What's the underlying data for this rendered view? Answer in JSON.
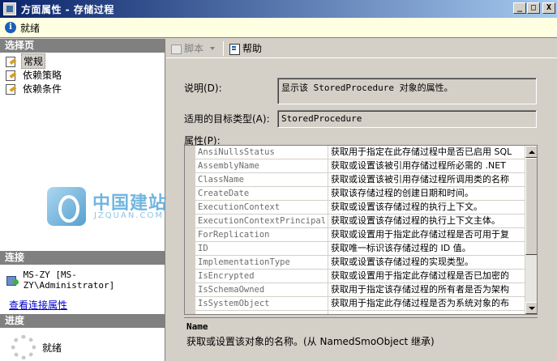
{
  "window": {
    "title": "方面属性 - 存储过程",
    "buttons": {
      "minimize": "_",
      "maximize": "□",
      "close": "X"
    }
  },
  "status": {
    "text": "就绪"
  },
  "left": {
    "select_page_header": "选择页",
    "pages": [
      {
        "label": "常规",
        "selected": true
      },
      {
        "label": "依赖策略",
        "selected": false
      },
      {
        "label": "依赖条件",
        "selected": false
      }
    ],
    "watermark": {
      "text": "中国建站圈",
      "sub": "JZQUAN.COM"
    },
    "connection_header": "连接",
    "connection_value": "MS-ZY [MS-ZY\\Administrator]",
    "connection_link": "查看连接属性",
    "progress_header": "进度",
    "progress_status": "就绪"
  },
  "toolbar": {
    "script_label": "脚本",
    "help_label": "帮助"
  },
  "form": {
    "description_label": "说明(D):",
    "description_value": "显示该 StoredProcedure 对象的属性。",
    "target_type_label": "适用的目标类型(A):",
    "target_type_value": "StoredProcedure",
    "properties_label": "属性(P):"
  },
  "properties": [
    {
      "name": "AnsiNullsStatus",
      "desc": "获取用于指定在此存储过程中是否已启用 SQL"
    },
    {
      "name": "AssemblyName",
      "desc": "获取或设置该被引用存储过程所必需的 .NET"
    },
    {
      "name": "ClassName",
      "desc": "获取或设置该被引用存储过程所调用类的名称"
    },
    {
      "name": "CreateDate",
      "desc": "获取该存储过程的创建日期和时间。"
    },
    {
      "name": "ExecutionContext",
      "desc": "获取或设置该存储过程的执行上下文。"
    },
    {
      "name": "ExecutionContextPrincipal",
      "desc": "获取或设置该存储过程的执行上下文主体。"
    },
    {
      "name": "ForReplication",
      "desc": "获取或设置用于指定此存储过程是否可用于复"
    },
    {
      "name": "ID",
      "desc": "获取唯一标识该存储过程的 ID 值。"
    },
    {
      "name": "ImplementationType",
      "desc": "获取或设置该存储过程的实现类型。"
    },
    {
      "name": "IsEncrypted",
      "desc": "获取或设置用于指定此存储过程是否已加密的"
    },
    {
      "name": "IsSchemaOwned",
      "desc": "获取用于指定该存储过程的所有者是否为架构"
    },
    {
      "name": "IsSystemObject",
      "desc": "获取用于指定此存储过程是否为系统对象的布"
    }
  ],
  "selected_property": {
    "name": "Name",
    "description": "获取或设置该对象的名称。(从 NamedSmoObject 继承)"
  }
}
